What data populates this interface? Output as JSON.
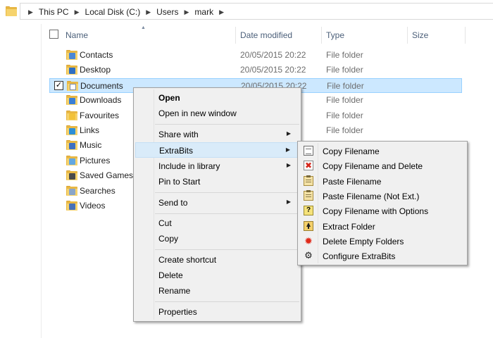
{
  "breadcrumb": [
    "This PC",
    "Local Disk (C:)",
    "Users",
    "mark"
  ],
  "columns": {
    "name": "Name",
    "date_modified": "Date modified",
    "type": "Type",
    "size": "Size"
  },
  "rows": [
    {
      "name": "Contacts",
      "date": "20/05/2015 20:22",
      "type": "File folder",
      "badge": "#4b88d6"
    },
    {
      "name": "Desktop",
      "date": "20/05/2015 20:22",
      "type": "File folder",
      "badge": "#2d6fc4"
    },
    {
      "name": "Documents",
      "date": "20/05/2015 20:22",
      "type": "File folder",
      "badge": "#ffffff",
      "selected": true
    },
    {
      "name": "Downloads",
      "date": "",
      "type": "File folder",
      "badge": "#3a7fd5"
    },
    {
      "name": "Favourites",
      "date": "",
      "type": "File folder",
      "badge": "#f2c23a"
    },
    {
      "name": "Links",
      "date": "",
      "type": "File folder",
      "badge": "#2d8fd6"
    },
    {
      "name": "Music",
      "date": "",
      "type": "",
      "badge": "#3d6fc2"
    },
    {
      "name": "Pictures",
      "date": "",
      "type": "",
      "badge": "#63a7e0"
    },
    {
      "name": "Saved Games",
      "date": "",
      "type": "",
      "badge": "#4a4a4a"
    },
    {
      "name": "Searches",
      "date": "",
      "type": "",
      "badge": "#8aa5c8"
    },
    {
      "name": "Videos",
      "date": "",
      "type": "",
      "badge": "#4770b8"
    }
  ],
  "context_menu": {
    "open": "Open",
    "open_new_window": "Open in new window",
    "share_with": "Share with",
    "extrabits": "ExtraBits",
    "include_in_library": "Include in library",
    "pin_to_start": "Pin to Start",
    "send_to": "Send to",
    "cut": "Cut",
    "copy": "Copy",
    "create_shortcut": "Create shortcut",
    "delete": "Delete",
    "rename": "Rename",
    "properties": "Properties"
  },
  "submenu": [
    {
      "label": "Copy Filename",
      "icon": "document-icon"
    },
    {
      "label": "Copy Filename and Delete",
      "icon": "red-x-icon"
    },
    {
      "label": "Paste Filename",
      "icon": "clipboard-icon"
    },
    {
      "label": "Paste Filename (Not Ext.)",
      "icon": "clipboard-icon"
    },
    {
      "label": "Copy Filename with Options",
      "icon": "question-icon"
    },
    {
      "label": "Extract Folder",
      "icon": "extract-folder-icon"
    },
    {
      "label": "Delete Empty Folders",
      "icon": "red-star-icon"
    },
    {
      "label": "Configure ExtraBits",
      "icon": "gear-icon"
    }
  ],
  "colors": {
    "selection": "#cce8ff",
    "selection_border": "#99d1ff",
    "menu_bg": "#f0f0f0",
    "menu_hover": "#d9ebf9",
    "header_text": "#4c607a"
  }
}
